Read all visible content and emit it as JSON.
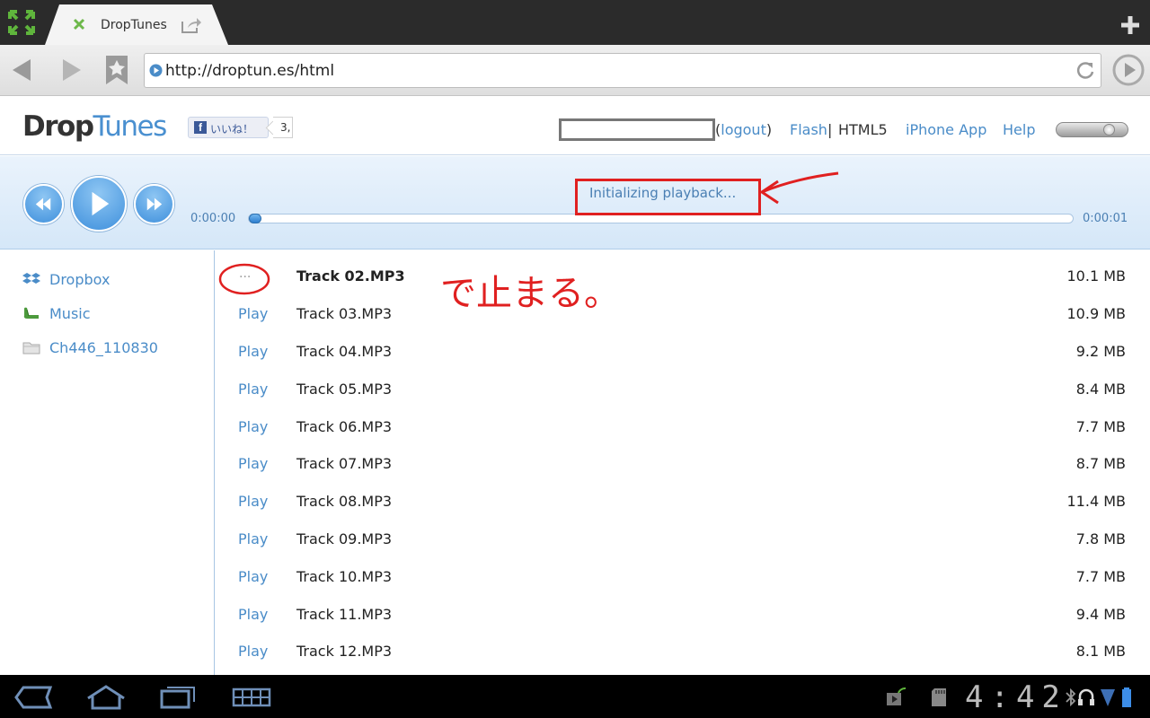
{
  "browser": {
    "tab_title": "DropTunes",
    "url": "http://droptun.es/html"
  },
  "site": {
    "logo_drop": "Drop",
    "logo_tunes": "Tunes",
    "like_label": "いいね！",
    "like_count": "3,",
    "logout_open": "(",
    "logout_label": "logout",
    "logout_close": ")",
    "nav": {
      "flash": "Flash",
      "separator": "|",
      "html5": "HTML5",
      "iphone": "iPhone App",
      "help": "Help"
    }
  },
  "player": {
    "status": "Initializing playback...",
    "elapsed": "0:00:00",
    "total": "0:00:01",
    "progress_fraction": 0.0
  },
  "sidebar": {
    "items": [
      {
        "label": "Dropbox",
        "icon": "dropbox-icon"
      },
      {
        "label": "Music",
        "icon": "folder-music-icon"
      },
      {
        "label": "Ch446_110830",
        "icon": "folder-icon"
      }
    ]
  },
  "tracks": [
    {
      "action": "...",
      "name": "Track 02.MP3",
      "size": "10.1 MB",
      "active": true
    },
    {
      "action": "Play",
      "name": "Track 03.MP3",
      "size": "10.9 MB"
    },
    {
      "action": "Play",
      "name": "Track 04.MP3",
      "size": "9.2 MB"
    },
    {
      "action": "Play",
      "name": "Track 05.MP3",
      "size": "8.4 MB"
    },
    {
      "action": "Play",
      "name": "Track 06.MP3",
      "size": "7.7 MB"
    },
    {
      "action": "Play",
      "name": "Track 07.MP3",
      "size": "8.7 MB"
    },
    {
      "action": "Play",
      "name": "Track 08.MP3",
      "size": "11.4 MB"
    },
    {
      "action": "Play",
      "name": "Track 09.MP3",
      "size": "7.8 MB"
    },
    {
      "action": "Play",
      "name": "Track 10.MP3",
      "size": "7.7 MB"
    },
    {
      "action": "Play",
      "name": "Track 11.MP3",
      "size": "9.4 MB"
    },
    {
      "action": "Play",
      "name": "Track 12.MP3",
      "size": "8.1 MB"
    }
  ],
  "annotation": {
    "handwritten_note": "で止まる。",
    "color": "#e02020"
  },
  "system": {
    "clock": "4:42"
  },
  "colors": {
    "link": "#4a8cc8",
    "accent": "#3f8fda",
    "annotation": "#e02020"
  }
}
